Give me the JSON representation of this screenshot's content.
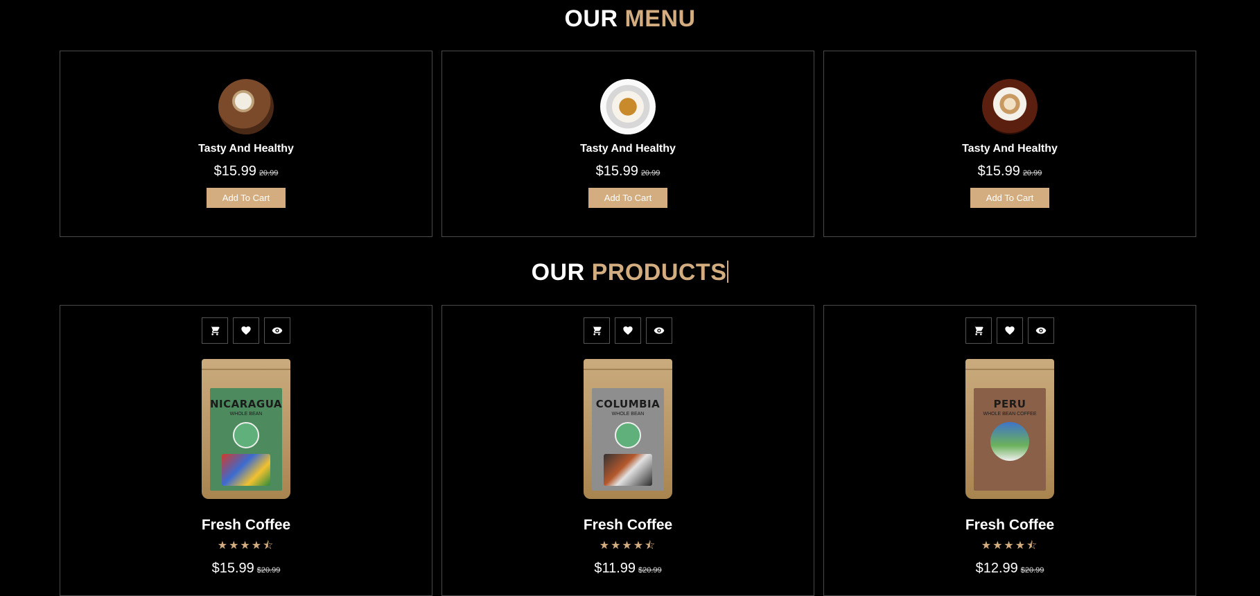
{
  "menu": {
    "heading_main": "OUR ",
    "heading_accent": "MENU",
    "items": [
      {
        "title": "Tasty And Healthy",
        "price": "$15.99",
        "old_price": "20.99",
        "button": "Add To Cart",
        "image": "cappuccino-cup-photo"
      },
      {
        "title": "Tasty And Healthy",
        "price": "$15.99",
        "old_price": "20.99",
        "button": "Add To Cart",
        "image": "espresso-cup-photo"
      },
      {
        "title": "Tasty And Healthy",
        "price": "$15.99",
        "old_price": "20.99",
        "button": "Add To Cart",
        "image": "latte-art-cup-photo"
      }
    ]
  },
  "products": {
    "heading_main": "OUR ",
    "heading_accent": "PRODUCTS",
    "icons": [
      "shopping-cart-icon",
      "heart-icon",
      "eye-icon"
    ],
    "items": [
      {
        "pack_origin": "NICARAGUA",
        "pack_sub": "WHOLE BEAN",
        "title": "Fresh Coffee",
        "stars": "★★★★⯪",
        "rating": 4.5,
        "price": "$15.99",
        "old_price": "$20.99"
      },
      {
        "pack_origin": "COLUMBIA",
        "pack_sub": "WHOLE BEAN",
        "title": "Fresh Coffee",
        "stars": "★★★★⯪",
        "rating": 4.5,
        "price": "$11.99",
        "old_price": "$20.99"
      },
      {
        "pack_origin": "PERU",
        "pack_sub": "WHOLE BEAN COFFEE",
        "title": "Fresh Coffee",
        "stars": "★★★★⯪",
        "rating": 4.5,
        "price": "$12.99",
        "old_price": "$20.99"
      }
    ]
  },
  "colors": {
    "background": "#000000",
    "accent": "#d3ad7f",
    "border": "#4a4a4a"
  }
}
